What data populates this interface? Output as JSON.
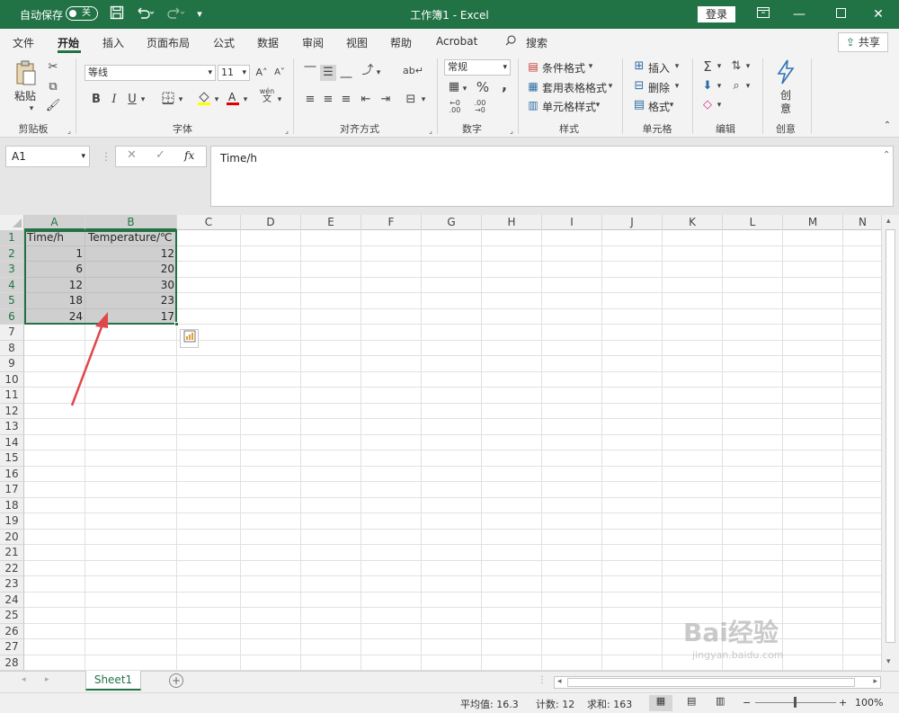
{
  "titlebar": {
    "autosave_label": "自动保存",
    "autosave_state": "关",
    "document_title": "工作簿1  -  Excel",
    "login_button": "登录",
    "qat_icons": [
      "save-icon",
      "undo-icon",
      "redo-icon",
      "customize-icon"
    ]
  },
  "menu": {
    "tabs": [
      "文件",
      "开始",
      "插入",
      "页面布局",
      "公式",
      "数据",
      "审阅",
      "视图",
      "帮助",
      "Acrobat"
    ],
    "search_label": "搜索",
    "share_label": "共享",
    "active_tab": "开始"
  },
  "ribbon": {
    "clipboard": {
      "paste_label": "粘贴",
      "group_label": "剪贴板"
    },
    "font": {
      "font_name": "等线",
      "font_size": "11",
      "group_label": "字体",
      "bold": "B",
      "italic": "I",
      "underline": "U",
      "wen_top": "wén",
      "wen_bottom": "文"
    },
    "alignment": {
      "group_label": "对齐方式"
    },
    "number": {
      "format": "常规",
      "group_label": "数字",
      "percent": "%"
    },
    "styles": {
      "conditional": "条件格式",
      "table_format": "套用表格格式",
      "cell_styles": "单元格样式",
      "group_label": "样式"
    },
    "cells": {
      "insert": "插入",
      "delete": "删除",
      "format": "格式",
      "group_label": "单元格"
    },
    "editing": {
      "group_label": "编辑"
    },
    "ideas": {
      "label_top": "创",
      "label_bottom": "意",
      "group_label": "创意"
    }
  },
  "formula_bar": {
    "name_box": "A1",
    "fx": "fx",
    "content": "Time/h"
  },
  "grid": {
    "columns": [
      "A",
      "B",
      "C",
      "D",
      "E",
      "F",
      "G",
      "H",
      "I",
      "J",
      "K",
      "L",
      "M",
      "N"
    ],
    "rows": [
      "1",
      "2",
      "3",
      "4",
      "5",
      "6",
      "7",
      "8",
      "9",
      "10",
      "11",
      "12",
      "13",
      "14",
      "15",
      "16",
      "17",
      "18",
      "19",
      "20",
      "21",
      "22",
      "23",
      "24",
      "25",
      "26",
      "27",
      "28"
    ],
    "headers": [
      "Time/h",
      "Temperature/℃"
    ],
    "data": [
      [
        "1",
        "12"
      ],
      [
        "6",
        "20"
      ],
      [
        "12",
        "30"
      ],
      [
        "18",
        "23"
      ],
      [
        "24",
        "17"
      ]
    ]
  },
  "sheets": {
    "tabs": [
      "Sheet1"
    ]
  },
  "status": {
    "average": "平均值: 16.3",
    "count": "计数: 12",
    "sum": "求和: 163",
    "zoom": "100%"
  },
  "watermark": {
    "main": "Bai经验",
    "sub": "jingyan.baidu.com"
  }
}
